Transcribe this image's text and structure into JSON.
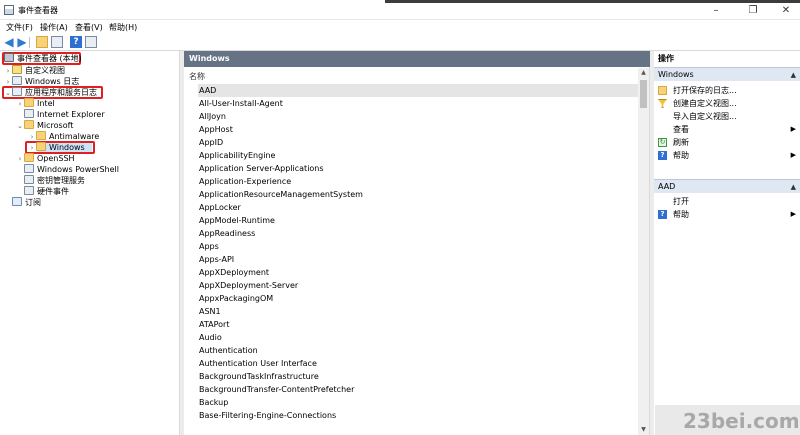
{
  "window": {
    "title": "事件查看器"
  },
  "menu": [
    "文件(F)",
    "操作(A)",
    "查看(V)",
    "帮助(H)"
  ],
  "tree": {
    "root": "事件查看器 (本地)",
    "custom_views": "自定义视图",
    "windows_logs": "Windows 日志",
    "apps_services": "应用程序和服务日志",
    "intel": "Intel",
    "ie": "Internet Explorer",
    "microsoft": "Microsoft",
    "antimalware": "Antimalware",
    "windows": "Windows",
    "openssh": "OpenSSH",
    "powershell": "Windows PowerShell",
    "key_mgmt": "密钥管理服务",
    "hardware": "硬件事件",
    "subscriptions": "订阅"
  },
  "middle": {
    "header": "Windows",
    "column_name": "名称",
    "items": [
      "AAD",
      "All-User-Install-Agent",
      "AllJoyn",
      "AppHost",
      "AppID",
      "ApplicabilityEngine",
      "Application Server-Applications",
      "Application-Experience",
      "ApplicationResourceManagementSystem",
      "AppLocker",
      "AppModel-Runtime",
      "AppReadiness",
      "Apps",
      "Apps-API",
      "AppXDeployment",
      "AppXDeployment-Server",
      "AppxPackagingOM",
      "ASN1",
      "ATAPort",
      "Audio",
      "Authentication",
      "Authentication User Interface",
      "BackgroundTaskInfrastructure",
      "BackgroundTransfer-ContentPrefetcher",
      "Backup",
      "Base-Filtering-Engine-Connections"
    ]
  },
  "actions": {
    "title": "操作",
    "section1": {
      "label": "Windows",
      "items": [
        {
          "label": "打开保存的日志...",
          "icon": "folder-icon"
        },
        {
          "label": "创建自定义视图...",
          "icon": "filter-icon"
        },
        {
          "label": "导入自定义视图...",
          "icon": "none"
        },
        {
          "label": "查看",
          "icon": "none",
          "submenu": true
        },
        {
          "label": "刷新",
          "icon": "refresh-icon"
        },
        {
          "label": "帮助",
          "icon": "help-icon",
          "submenu": true
        }
      ]
    },
    "section2": {
      "label": "AAD",
      "items": [
        {
          "label": "打开",
          "icon": "none"
        },
        {
          "label": "帮助",
          "icon": "help-icon",
          "submenu": true
        }
      ]
    }
  },
  "watermark": "23bei.com",
  "colors": {
    "highlight_box": "#e02020",
    "pane_header": "#657385",
    "section_bg": "#dfe7f2"
  }
}
